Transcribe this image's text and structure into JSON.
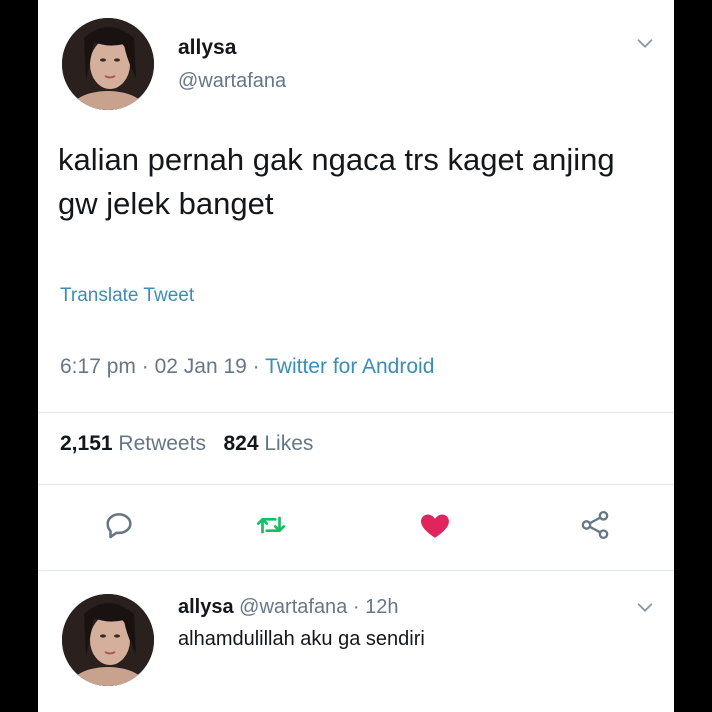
{
  "tweet": {
    "display_name": "allysa",
    "handle": "@wartafana",
    "text": "kalian pernah gak ngaca trs kaget anjing gw jelek banget",
    "translate_label": "Translate Tweet",
    "time": "6:17 pm",
    "date": "02 Jan 19",
    "separator": "·",
    "source": "Twitter for Android",
    "retweets_count": "2,151",
    "retweets_label": "Retweets",
    "likes_count": "824",
    "likes_label": "Likes",
    "liked": true
  },
  "actions": {
    "reply_icon": "reply-icon",
    "retweet_icon": "retweet-icon",
    "like_icon": "heart-icon",
    "share_icon": "share-icon"
  },
  "reply": {
    "display_name": "allysa",
    "handle": "@wartafana",
    "separator": "·",
    "age": "12h",
    "text": "alhamdulillah aku ga sendiri"
  },
  "colors": {
    "link": "#3a8db6",
    "retweet": "#17bf63",
    "like": "#e0245e",
    "muted": "#657786",
    "text": "#14171a"
  }
}
